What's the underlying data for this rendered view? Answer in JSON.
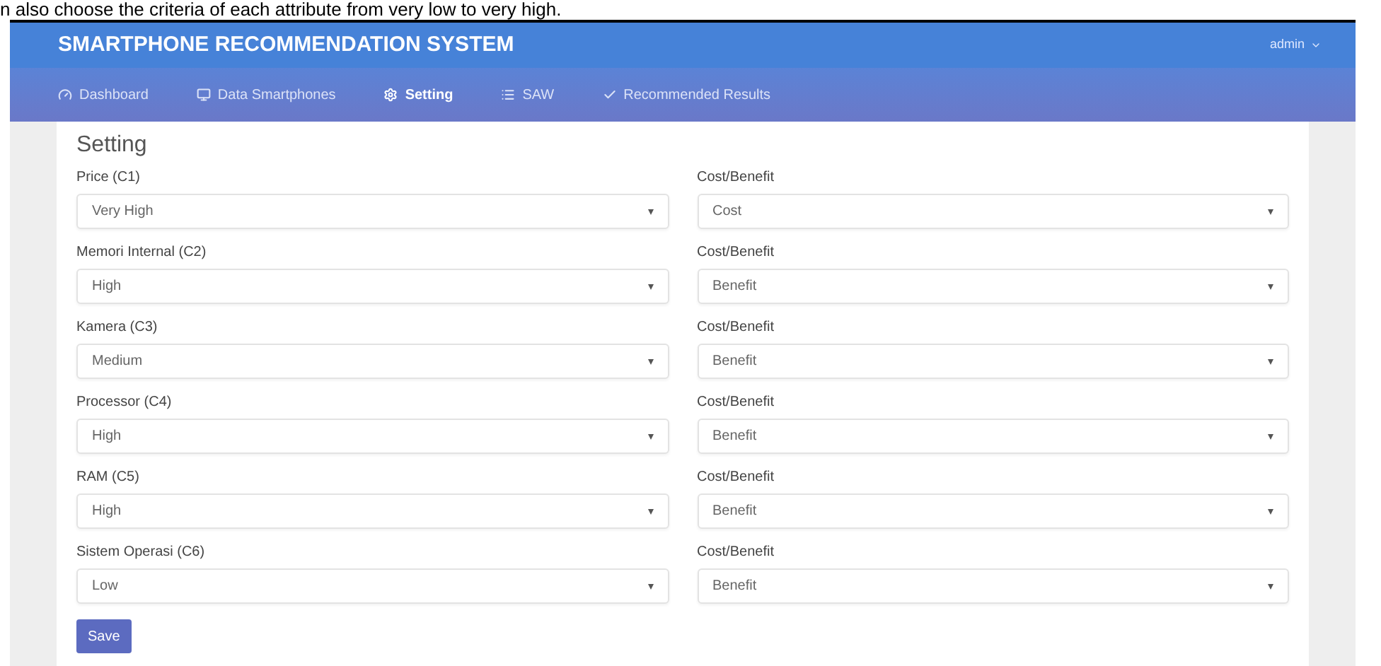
{
  "caption": "n also choose the criteria of each attribute from very low to very high.",
  "app": {
    "title": "SMARTPHONE RECOMMENDATION SYSTEM",
    "user_menu": "admin"
  },
  "nav": [
    {
      "label": "Dashboard",
      "selected": false
    },
    {
      "label": "Data Smartphones",
      "selected": false
    },
    {
      "label": "Setting",
      "selected": true
    },
    {
      "label": "SAW",
      "selected": false
    },
    {
      "label": "Recommended Results",
      "selected": false
    }
  ],
  "form": {
    "title": "Setting",
    "rows": [
      {
        "label": "Price (C1)",
        "value": "Very High",
        "type_label": "Cost/Benefit",
        "type_value": "Cost"
      },
      {
        "label": "Memori Internal (C2)",
        "value": "High",
        "type_label": "Cost/Benefit",
        "type_value": "Benefit"
      },
      {
        "label": "Kamera (C3)",
        "value": "Medium",
        "type_label": "Cost/Benefit",
        "type_value": "Benefit"
      },
      {
        "label": "Processor (C4)",
        "value": "High",
        "type_label": "Cost/Benefit",
        "type_value": "Benefit"
      },
      {
        "label": "RAM (C5)",
        "value": "High",
        "type_label": "Cost/Benefit",
        "type_value": "Benefit"
      },
      {
        "label": "Sistem Operasi (C6)",
        "value": "Low",
        "type_label": "Cost/Benefit",
        "type_value": "Benefit"
      }
    ],
    "save_button": "Save"
  }
}
